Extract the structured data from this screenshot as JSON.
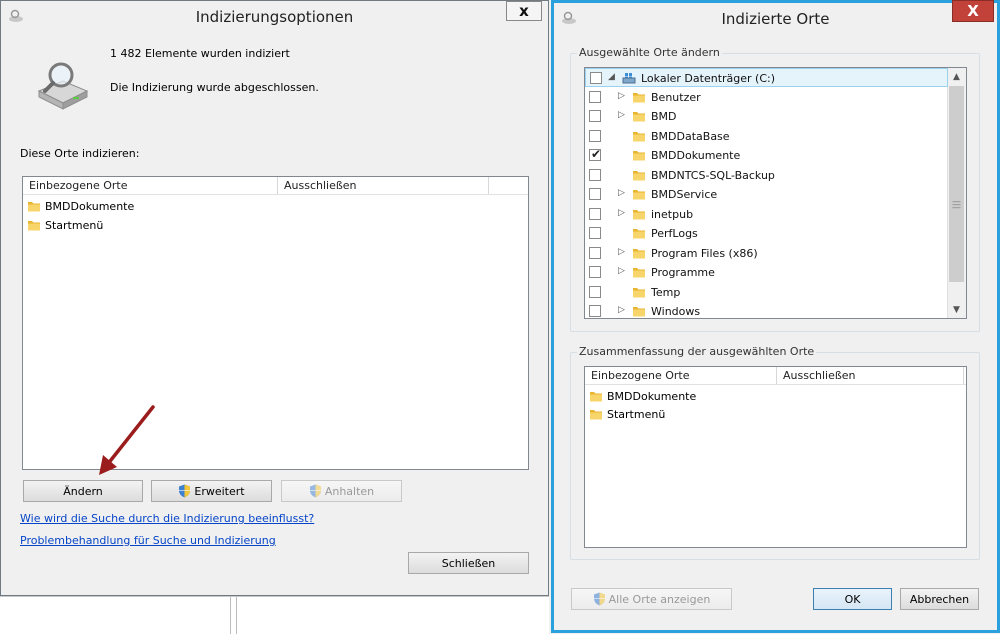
{
  "left_window": {
    "title": "Indizierungsoptionen",
    "close_label": "x",
    "status_count": "1 482 Elemente wurden indiziert",
    "status_message": "Die Indizierung wurde abgeschlossen.",
    "section_label": "Diese Orte indizieren:",
    "columns": [
      "Einbezogene Orte",
      "Ausschließen"
    ],
    "locations": [
      "BMDDokumente",
      "Startmenü"
    ],
    "buttons": {
      "change": "Ändern",
      "advanced": "Erweitert",
      "pause": "Anhalten",
      "close": "Schließen"
    },
    "links": [
      "Wie wird die Suche durch die Indizierung beeinflusst?",
      "Problembehandlung für Suche und Indizierung"
    ]
  },
  "right_window": {
    "title": "Indizierte Orte",
    "close_label": "X",
    "group_change": "Ausgewählte Orte ändern",
    "tree": [
      {
        "label": "Lokaler Datenträger (C:)",
        "checked": false,
        "expander": "◢",
        "icon": "drive-icon",
        "root": true
      },
      {
        "label": "Benutzer",
        "checked": false,
        "expander": "▷"
      },
      {
        "label": "BMD",
        "checked": false,
        "expander": "▷"
      },
      {
        "label": "BMDDataBase",
        "checked": false,
        "expander": ""
      },
      {
        "label": "BMDDokumente",
        "checked": true,
        "expander": ""
      },
      {
        "label": "BMDNTCS-SQL-Backup",
        "checked": false,
        "expander": ""
      },
      {
        "label": "BMDService",
        "checked": false,
        "expander": "▷"
      },
      {
        "label": "inetpub",
        "checked": false,
        "expander": "▷"
      },
      {
        "label": "PerfLogs",
        "checked": false,
        "expander": ""
      },
      {
        "label": "Program Files (x86)",
        "checked": false,
        "expander": "▷"
      },
      {
        "label": "Programme",
        "checked": false,
        "expander": "▷"
      },
      {
        "label": "Temp",
        "checked": false,
        "expander": ""
      },
      {
        "label": "Windows",
        "checked": false,
        "expander": "▷"
      }
    ],
    "group_summary": "Zusammenfassung der ausgewählten Orte",
    "columns": [
      "Einbezogene Orte",
      "Ausschließen"
    ],
    "locations": [
      "BMDDokumente",
      "Startmenü"
    ],
    "buttons": {
      "show_all": "Alle Orte anzeigen",
      "ok": "OK",
      "cancel": "Abbrechen"
    }
  },
  "colors": {
    "accent_border": "#2aa0dc",
    "close_red": "#c2423a",
    "link": "#0645c8",
    "annotation_arrow": "#9b1c1c"
  }
}
